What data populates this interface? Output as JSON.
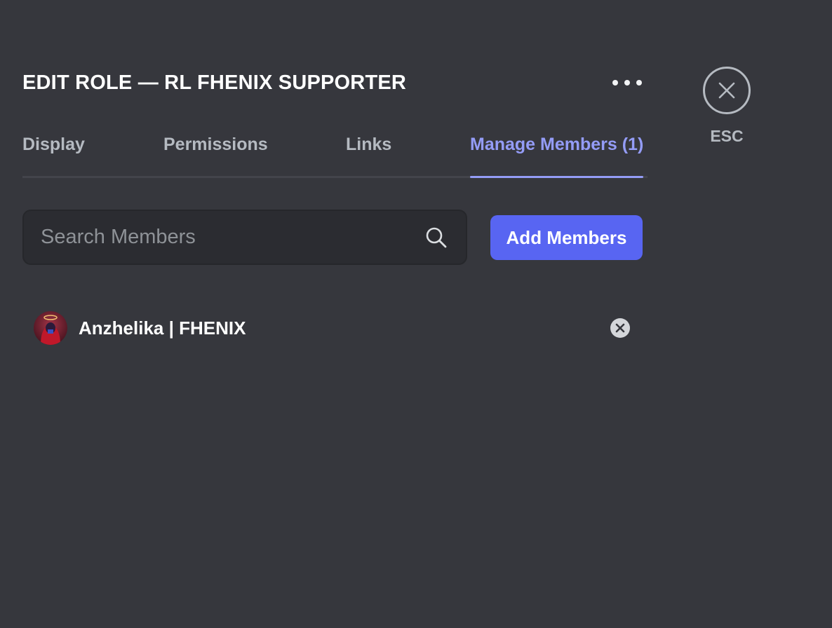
{
  "header": {
    "title": "EDIT ROLE — RL FHENIX SUPPORTER",
    "more_icon": "ellipsis-icon"
  },
  "tabs": [
    {
      "label": "Display",
      "active": false
    },
    {
      "label": "Permissions",
      "active": false
    },
    {
      "label": "Links",
      "active": false
    },
    {
      "label": "Manage Members (1)",
      "active": true
    }
  ],
  "esc": {
    "label": "ESC",
    "icon": "close-icon"
  },
  "search": {
    "placeholder": "Search Members",
    "value": "",
    "icon": "search-icon"
  },
  "add_members": {
    "label": "Add Members"
  },
  "members": [
    {
      "name": "Anzhelika | FHENIX",
      "remove_icon": "remove-circle-icon"
    }
  ],
  "colors": {
    "background": "#36373d",
    "accent": "#949cf7",
    "button": "#5865f2",
    "muted_text": "#b5bac1"
  }
}
